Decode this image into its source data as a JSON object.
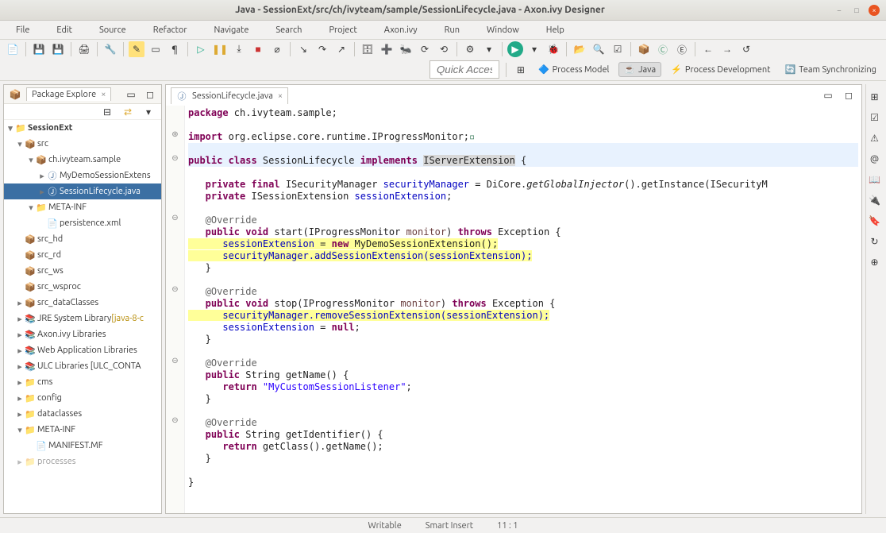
{
  "titlebar": {
    "title": "Java - SessionExt/src/ch/ivyteam/sample/SessionLifecycle.java - Axon.ivy Designer"
  },
  "menu": {
    "file": "File",
    "edit": "Edit",
    "source": "Source",
    "refactor": "Refactor",
    "navigate": "Navigate",
    "search": "Search",
    "project": "Project",
    "axon": "Axon.ivy",
    "run": "Run",
    "window": "Window",
    "help": "Help"
  },
  "quick_access": {
    "placeholder": "Quick Access"
  },
  "perspectives": {
    "process_model": "Process Model",
    "java": "Java",
    "process_dev": "Process Development",
    "team_sync": "Team Synchronizing"
  },
  "explorer": {
    "tab": "Package Explore",
    "tree": {
      "project": "SessionExt",
      "src": "src",
      "pkg": "ch.ivyteam.sample",
      "file1": "MyDemoSessionExtens",
      "file2": "SessionLifecycle.java",
      "metainf": "META-INF",
      "persist": "persistence.xml",
      "src_hd": "src_hd",
      "src_rd": "src_rd",
      "src_ws": "src_ws",
      "src_wsproc": "src_wsproc",
      "src_dc": "src_dataClasses",
      "jre": "JRE System Library ",
      "jre_suffix": "[java-8-c",
      "axon_lib": "Axon.ivy Libraries",
      "web_lib": "Web Application Libraries",
      "ulc": "ULC Libraries [ULC_CONTA",
      "cms": "cms",
      "config": "config",
      "dataclasses": "dataclasses",
      "metainf2": "META-INF",
      "manifest": "MANIFEST.MF",
      "processes": "processes"
    }
  },
  "editor": {
    "tab": "SessionLifecycle.java",
    "code": {
      "l1_pkg": "package",
      "l1_name": " ch.ivyteam.sample;",
      "l3_imp": "import",
      "l3_rest": " org.eclipse.core.runtime.IProgressMonitor;",
      "l5_a": "public class ",
      "l5_b": "SessionLifecycle ",
      "l5_c": "implements ",
      "l5_d": "IServerExtension",
      "l5_e": " {",
      "l7": "   private final ",
      "l7b": "ISecurityManager ",
      "l7c": "securityManager",
      "l7d": " = DiCore.",
      "l7e": "getGlobalInjector",
      "l7f": "().getInstance(ISecurityM",
      "l8": "   private ",
      "l8b": "ISessionExtension ",
      "l8c": "sessionExtension",
      "l8d": ";",
      "l10": "   @Override",
      "l11": "   public void ",
      "l11b": "start(IProgressMonitor ",
      "l11c": "monitor",
      "l11d": ") ",
      "l11e": "throws ",
      "l11f": "Exception {",
      "l12": "      sessionExtension",
      "l12b": " = ",
      "l12c": "new ",
      "l12d": "MyDemoSessionExtension();",
      "l13": "      securityManager.addSessionExtension(sessionExtension);",
      "l14": "   }",
      "l16": "   @Override",
      "l17": "   public void ",
      "l17b": "stop(IProgressMonitor ",
      "l17c": "monitor",
      "l17d": ") ",
      "l17e": "throws ",
      "l17f": "Exception {",
      "l18": "      securityManager.removeSessionExtension(sessionExtension);",
      "l19": "      sessionExtension",
      "l19b": " = ",
      "l19c": "null",
      "l19d": ";",
      "l20": "   }",
      "l22": "   @Override",
      "l23": "   public ",
      "l23b": "String getName() {",
      "l24": "      return ",
      "l24b": "\"MyCustomSessionListener\"",
      "l24c": ";",
      "l25": "   }",
      "l27": "   @Override",
      "l28": "   public ",
      "l28b": "String getIdentifier() {",
      "l29": "      return ",
      "l29b": "getClass().getName();",
      "l30": "   }",
      "l32": "}"
    }
  },
  "status": {
    "writable": "Writable",
    "insert": "Smart Insert",
    "pos": "11 : 1"
  }
}
